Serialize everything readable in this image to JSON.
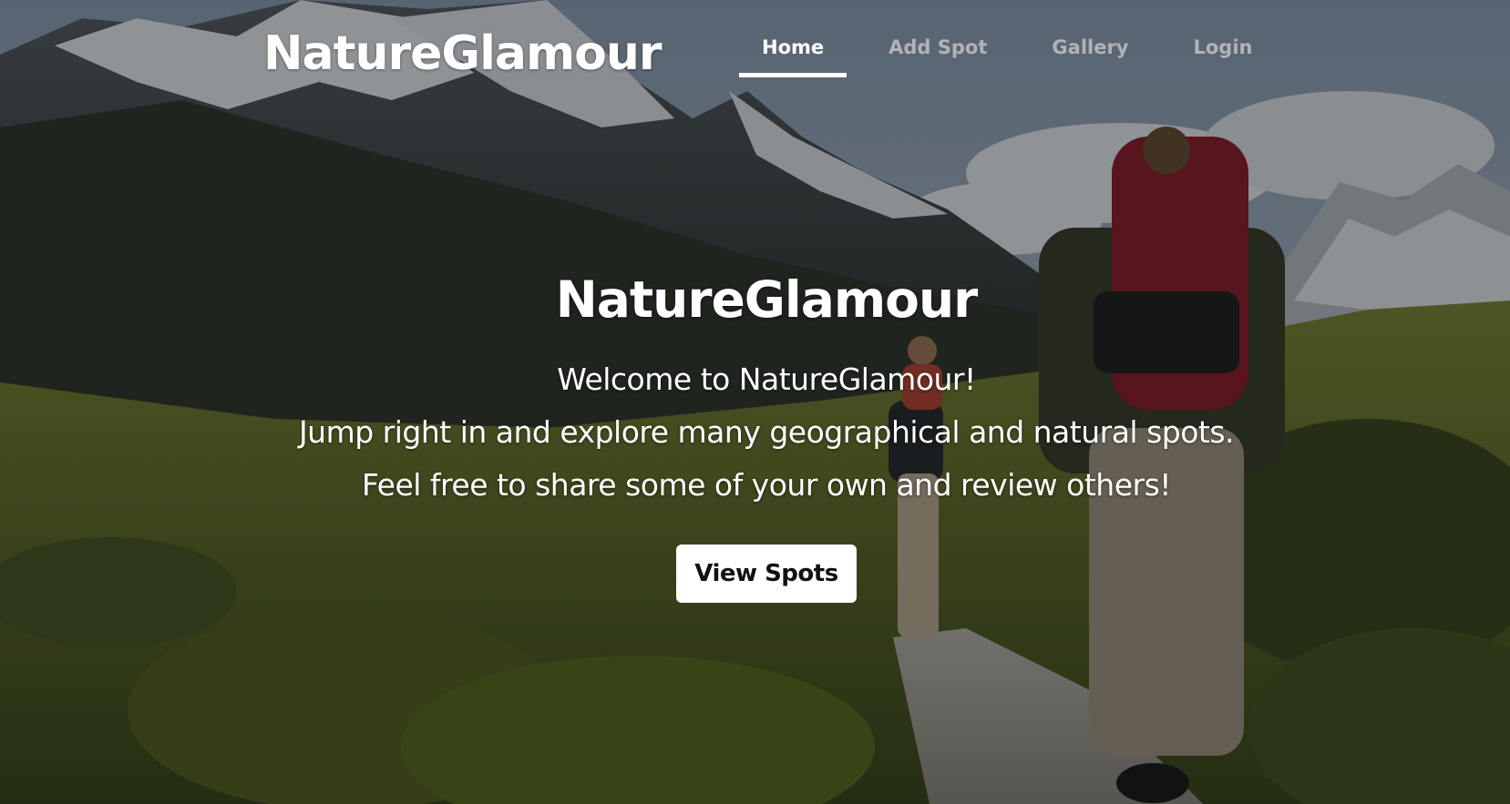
{
  "header": {
    "brand": "NatureGlamour",
    "nav": [
      {
        "label": "Home",
        "active": true
      },
      {
        "label": "Add Spot",
        "active": false
      },
      {
        "label": "Gallery",
        "active": false
      },
      {
        "label": "Login",
        "active": false
      }
    ]
  },
  "hero": {
    "title": "NatureGlamour",
    "lines": [
      "Welcome to NatureGlamour!",
      "Jump right in and explore many geographical and natural spots.",
      "Feel free to share some of your own and review others!"
    ],
    "cta_label": "View Spots"
  },
  "colors": {
    "text": "#ffffff",
    "nav_inactive": "#c7c7c7",
    "button_bg": "#ffffff",
    "button_text": "#111111"
  }
}
